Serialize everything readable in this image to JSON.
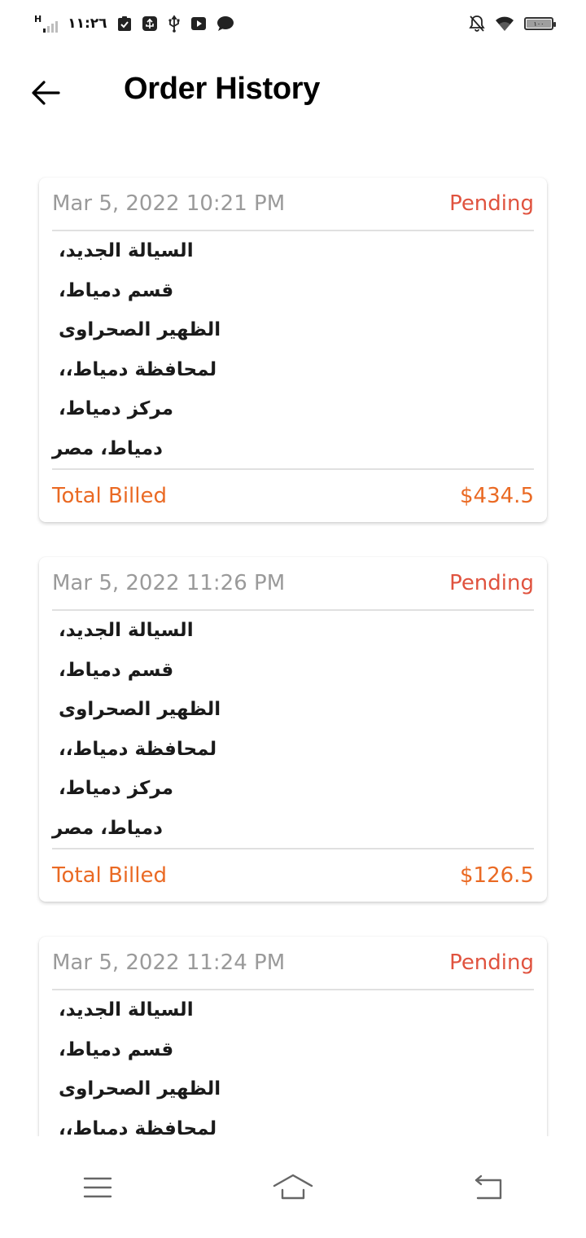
{
  "status_bar": {
    "network_type": "H",
    "time": "١١:٢٦",
    "battery_level": "١٠٠",
    "icons": [
      "signal-icon",
      "checklist-icon",
      "usb-debug-icon",
      "usb-icon",
      "youtube-icon",
      "message-icon",
      "notifications-off-icon",
      "wifi-icon",
      "battery-icon"
    ]
  },
  "header": {
    "title": "Order History",
    "back_icon": "arrow-left-icon"
  },
  "orders": [
    {
      "date": "Mar 5, 2022 10:21 PM",
      "status": "Pending",
      "address_lines": [
        "السيالة الجديد،",
        "قسم دمياط،",
        "الظهير الصحراوى",
        "لمحافظة دمياط،،",
        "مركز دمياط،",
        "دمياط، مصر"
      ],
      "total_label": "Total Billed",
      "total_value": "$434.5"
    },
    {
      "date": "Mar 5, 2022 11:26 PM",
      "status": "Pending",
      "address_lines": [
        "السيالة الجديد،",
        "قسم دمياط،",
        "الظهير الصحراوى",
        "لمحافظة دمياط،،",
        "مركز دمياط،",
        "دمياط، مصر"
      ],
      "total_label": "Total Billed",
      "total_value": "$126.5"
    },
    {
      "date": "Mar 5, 2022 11:24 PM",
      "status": "Pending",
      "address_lines": [
        "السيالة الجديد،",
        "قسم دمياط،",
        "الظهير الصحراوى",
        "لمحافظة دمياط،،"
      ],
      "total_label": "",
      "total_value": ""
    }
  ],
  "nav_bar": {
    "icons": [
      "menu-icon",
      "home-icon",
      "back-icon"
    ]
  },
  "colors": {
    "status_pending": "#e0533f",
    "total_accent": "#ea6a24",
    "date_gray": "#9a9a9a"
  }
}
